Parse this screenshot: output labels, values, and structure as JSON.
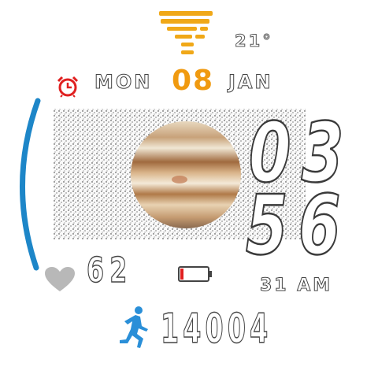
{
  "weather": {
    "icon": "fog-icon",
    "temperature": "21°",
    "icon_color": "#f0a818"
  },
  "date": {
    "weekday": "MON",
    "day": "08",
    "month": "JAN",
    "day_color": "#f09a10"
  },
  "alarm": {
    "icon": "alarm-clock-icon",
    "color": "#e02020"
  },
  "time": {
    "hours": "03",
    "minutes": "56",
    "seconds": "31",
    "ampm": "AM",
    "seconds_ampm": "31 AM"
  },
  "heart_rate": {
    "icon": "heart-icon",
    "value": "62"
  },
  "battery": {
    "icon": "battery-icon",
    "level_fraction": 0.1,
    "color": "#e02020"
  },
  "steps": {
    "icon": "runner-icon",
    "value": "14004",
    "icon_color": "#2a8fd8"
  },
  "arc": {
    "color": "#1d86c8",
    "level_fraction": 0.55
  },
  "background_image": {
    "icon": "jupiter-image"
  }
}
